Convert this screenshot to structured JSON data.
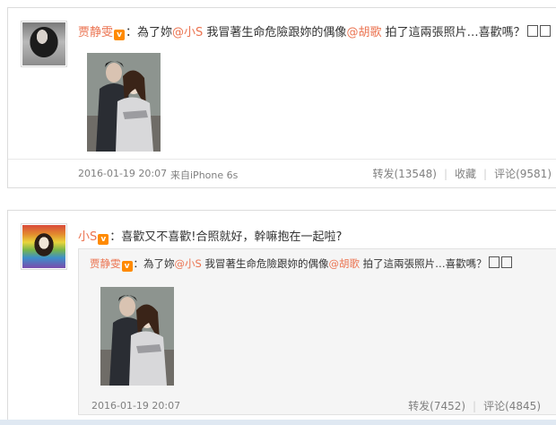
{
  "post1": {
    "username": "贾静雯",
    "verified_badge": "v",
    "text_before_mention1": "：為了妳",
    "mention1": "@小S",
    "text_between": " 我冒著生命危險跟妳的偶像",
    "mention2": "@胡歌",
    "text_after": " 拍了這兩張照片…喜歡嗎？",
    "time": "2016-01-19 20:07",
    "source": "来自iPhone 6s",
    "repost_label": "转发(13548)",
    "favorite_label": "收藏",
    "comment_label": "评论(9581)"
  },
  "post2": {
    "username": "小S",
    "verified_badge": "v",
    "text": "：喜歡又不喜歡!合照就好，幹嘛抱在一起啦?",
    "repost": {
      "username": "贾静雯",
      "verified_badge": "v",
      "text_before_mention1": "：為了妳",
      "mention1": "@小S",
      "text_between": " 我冒著生命危險跟妳的偶像",
      "mention2": "@胡歌",
      "text_after": " 拍了這兩張照片…喜歡嗎？",
      "time": "2016-01-19 20:07",
      "repost_label": "转发(7452)",
      "comment_label": "评论(4845)"
    }
  },
  "colors": {
    "accent": "#eb7350",
    "meta_text": "#808080",
    "badge": "#ff8a00"
  }
}
